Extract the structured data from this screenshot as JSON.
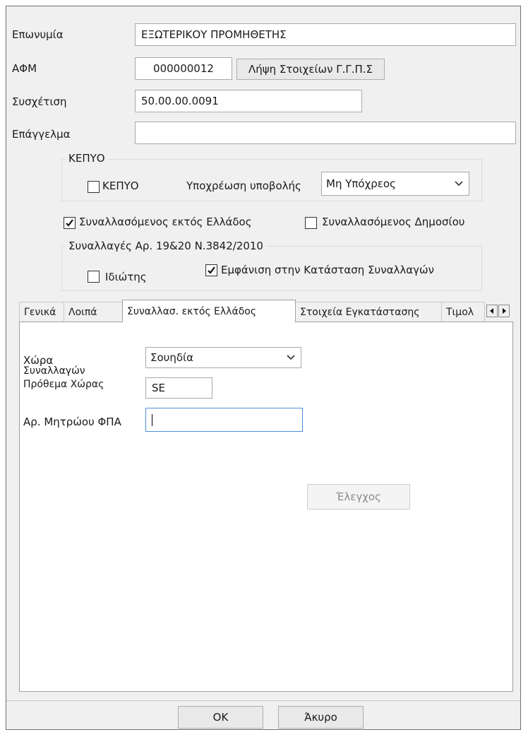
{
  "form": {
    "name_label": "Επωνυμία",
    "name_value": "ΕΞΩΤΕΡΙΚΟΥ ΠΡΟΜΗΘΕΤΗΣ",
    "afm_label": "ΑΦΜ",
    "afm_value": "000000012",
    "gsis_button": "Λήψη Στοιχείων Γ.Γ.Π.Σ",
    "relation_label": "Συσχέτιση",
    "relation_value": "50.00.00.0091",
    "profession_label": "Επάγγελμα",
    "profession_value": ""
  },
  "kepyo": {
    "group_title": "ΚΕΠΥΟ",
    "checkbox_label": "ΚΕΠΥΟ",
    "checked": false,
    "obligation_label": "Υποχρέωση υποβολής",
    "obligation_value": "Μη Υπόχρεος"
  },
  "flags": {
    "abroad_label": "Συναλλασόμενος εκτός Ελλάδος",
    "abroad_checked": true,
    "public_label": "Συναλλασόμενος Δημοσίου",
    "public_checked": false
  },
  "transactions": {
    "group_title": "Συναλλαγές Αρ. 19&20 Ν.3842/2010",
    "individual_label": "Ιδιώτης",
    "individual_checked": false,
    "show_label": "Εμφάνιση στην Κατάσταση Συναλλαγών",
    "show_checked": true
  },
  "tabs": [
    {
      "label": "Γενικά",
      "active": false
    },
    {
      "label": "Λοιπά",
      "active": false
    },
    {
      "label": "Συναλλασ. εκτός Ελλάδος",
      "active": true
    },
    {
      "label": "Στοιχεία Εγκατάστασης",
      "active": false
    },
    {
      "label": "Τιμολ",
      "active": false
    }
  ],
  "tab_panel": {
    "country_label_1": "Χώρα",
    "country_label_2": "Συναλλαγών",
    "country_value": "Σουηδία",
    "prefix_label": "Πρόθεμα Χώρας",
    "prefix_value": "SE",
    "vat_label": "Αρ. Μητρώου ΦΠΑ",
    "vat_value": "",
    "check_button": "Έλεγχος"
  },
  "footer": {
    "ok_label": "OK",
    "cancel_label": "Άκυρο"
  },
  "icons": {
    "checkmark": "checkmark-icon",
    "dropdown": "chevron-down-icon",
    "scroll_left": "arrow-left-icon",
    "scroll_right": "arrow-right-icon"
  },
  "colors": {
    "dialog_bg": "#f0f0f0",
    "panel_bg": "#ffffff",
    "border": "#a9a9a9",
    "disabled_text": "#8a8a8a"
  }
}
